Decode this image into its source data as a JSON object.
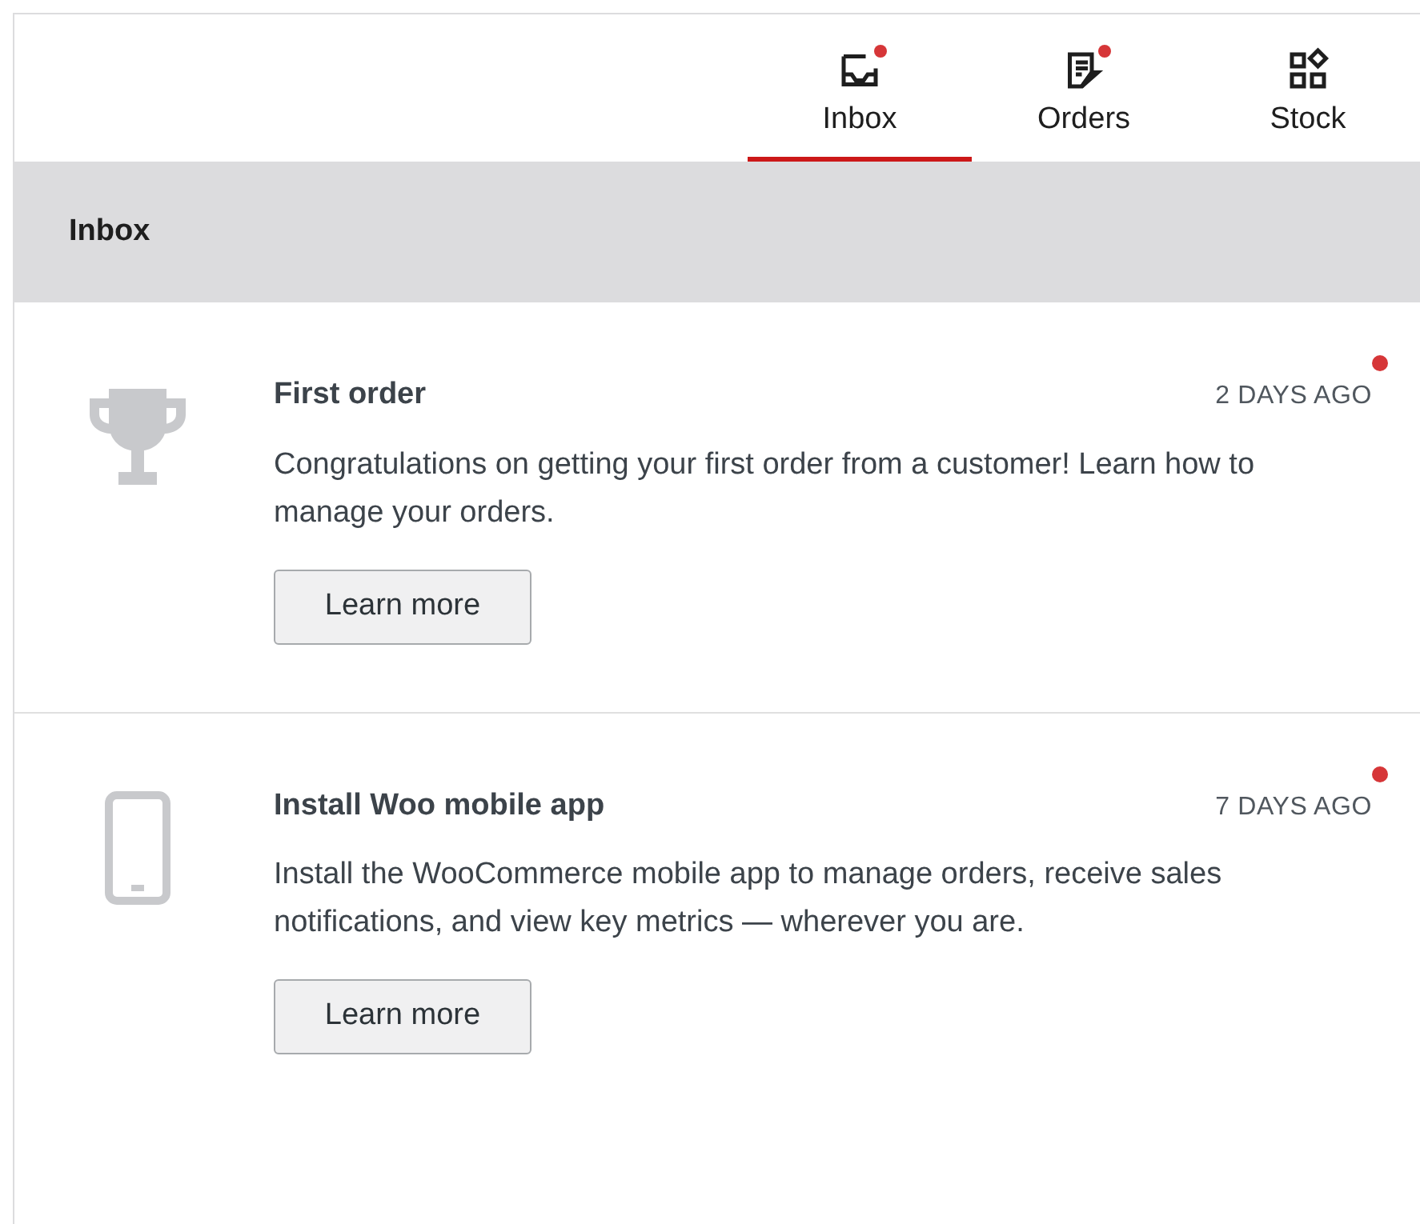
{
  "tabs": [
    {
      "label": "Inbox",
      "kind": "inbox",
      "selected": true,
      "unread": true
    },
    {
      "label": "Orders",
      "kind": "orders",
      "selected": false,
      "unread": true
    },
    {
      "label": "Stock",
      "kind": "stock",
      "selected": false,
      "unread": false
    }
  ],
  "section_header": "Inbox",
  "notes": [
    {
      "kind": "trophy",
      "title": "First order",
      "date": "2 DAYS AGO",
      "unread": true,
      "body": "Congratulations on getting your first order from a customer! Learn how to manage your orders.",
      "button": "Learn more"
    },
    {
      "kind": "phone",
      "title": "Install Woo mobile app",
      "date": "7 DAYS AGO",
      "unread": true,
      "body": "Install the WooCommerce mobile app to manage orders, receive sales notifications, and view key metrics — wherever you are.",
      "button": "Learn more"
    }
  ]
}
